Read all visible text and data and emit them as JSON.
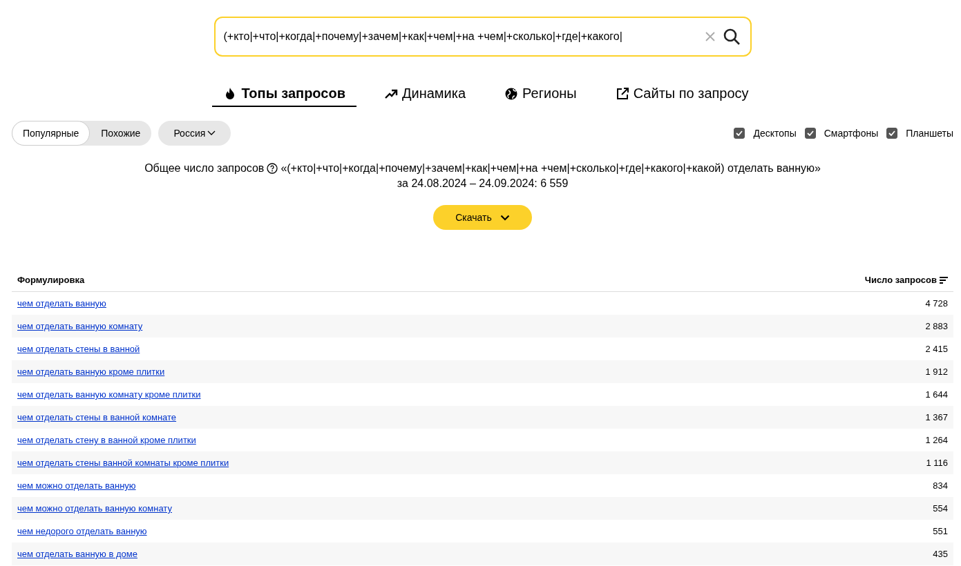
{
  "search": {
    "value": "(+кто|+что|+когда|+почему|+зачем|+как|+чем|+на +чем|+сколько|+где|+какого|"
  },
  "tabs": [
    {
      "label": "Топы запросов",
      "kind": "flame",
      "selected": true
    },
    {
      "label": "Динамика",
      "kind": "trend",
      "selected": false
    },
    {
      "label": "Регионы",
      "kind": "globe",
      "selected": false
    },
    {
      "label": "Сайты по запросу",
      "kind": "external",
      "selected": false
    }
  ],
  "mode_switch": [
    {
      "label": "Популярные",
      "selected": true
    },
    {
      "label": "Похожие",
      "selected": false
    }
  ],
  "region": {
    "label": "Россия"
  },
  "devices": [
    {
      "label": "Десктопы",
      "checked": true
    },
    {
      "label": "Смартфоны",
      "checked": true
    },
    {
      "label": "Планшеты",
      "checked": true
    }
  ],
  "summary": {
    "label": "Общее число запросов",
    "query": "«(+кто|+что|+когда|+почему|+зачем|+как|+чем|+на +чем|+сколько|+где|+какого|+какой) отделать ванную»",
    "period": "за 24.08.2024 – 24.09.2024: 6 559"
  },
  "download_button": {
    "label": "Скачать"
  },
  "table": {
    "columns": [
      "Формулировка",
      "Число запросов"
    ],
    "rows": [
      {
        "phrase": "чем отделать ванную",
        "count": "4 728"
      },
      {
        "phrase": "чем отделать ванную комнату",
        "count": "2 883"
      },
      {
        "phrase": "чем отделать стены в ванной",
        "count": "2 415"
      },
      {
        "phrase": "чем отделать ванную кроме плитки",
        "count": "1 912"
      },
      {
        "phrase": "чем отделать ванную комнату кроме плитки",
        "count": "1 644"
      },
      {
        "phrase": "чем отделать стены в ванной комнате",
        "count": "1 367"
      },
      {
        "phrase": "чем отделать стену в ванной кроме плитки",
        "count": "1 264"
      },
      {
        "phrase": "чем отделать стены ванной комнаты кроме плитки",
        "count": "1 116"
      },
      {
        "phrase": "чем можно отделать ванную",
        "count": "834"
      },
      {
        "phrase": "чем можно отделать ванную комнату",
        "count": "554"
      },
      {
        "phrase": "чем недорого отделать ванную",
        "count": "551"
      },
      {
        "phrase": "чем отделать ванную в доме",
        "count": "435"
      }
    ]
  }
}
